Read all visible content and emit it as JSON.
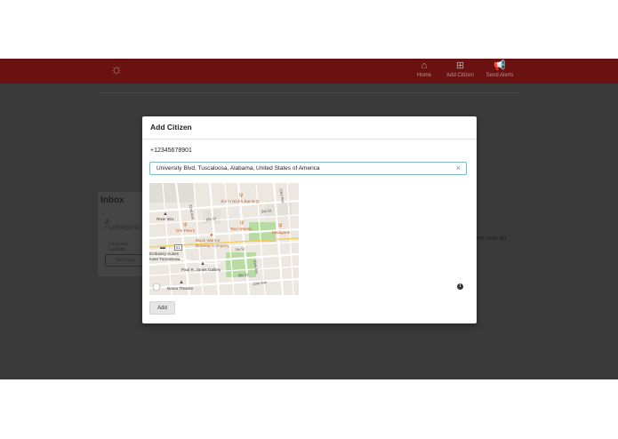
{
  "navbar": {
    "logo_icon": "sun-logo-icon",
    "items": [
      {
        "label": "Home",
        "icon": "home-icon"
      },
      {
        "label": "Add Citizen",
        "icon": "add-square-icon"
      },
      {
        "label": "Send Alerts",
        "icon": "megaphone-icon"
      }
    ]
  },
  "background": {
    "inbox_title": "Inbox",
    "phone": "+12054502797",
    "row_text": "I'm at hos",
    "row_sub": "Location",
    "button_label": "Show Map",
    "side_text": "ere was an"
  },
  "modal": {
    "title": "Add Citizen",
    "phone": "+12345678901",
    "address_value": "University Blvd, Tuscaloosa, Alabama, United States of America",
    "clear_icon": "close-x-icon",
    "info_icon": "info-icon",
    "add_label": "Add",
    "map": {
      "labels": {
        "jims": "Jim 'n Nick's Bar-B-Q",
        "river": "River 601",
        "dinos": "Dre Pete's",
        "taco": "Taco Mama",
        "madigans": "Madigans",
        "black_warrior": "Black Warrior\nBrewing Company",
        "embassy": "Embassy Suites\nhotel Tuscaloosa",
        "paul_jones": "Paul R. Jones Gallery",
        "bama": "Bama Theatre",
        "st_6th_a": "6th St",
        "st_6th_b": "6th St",
        "st_7th": "7th St",
        "st_22nd": "22nd Ave",
        "st_21st": "21st Ave",
        "st_23rd": "23rd Ave",
        "st_8th": "8th St",
        "st_19th": "19th Ave",
        "hwy": "82"
      }
    }
  }
}
